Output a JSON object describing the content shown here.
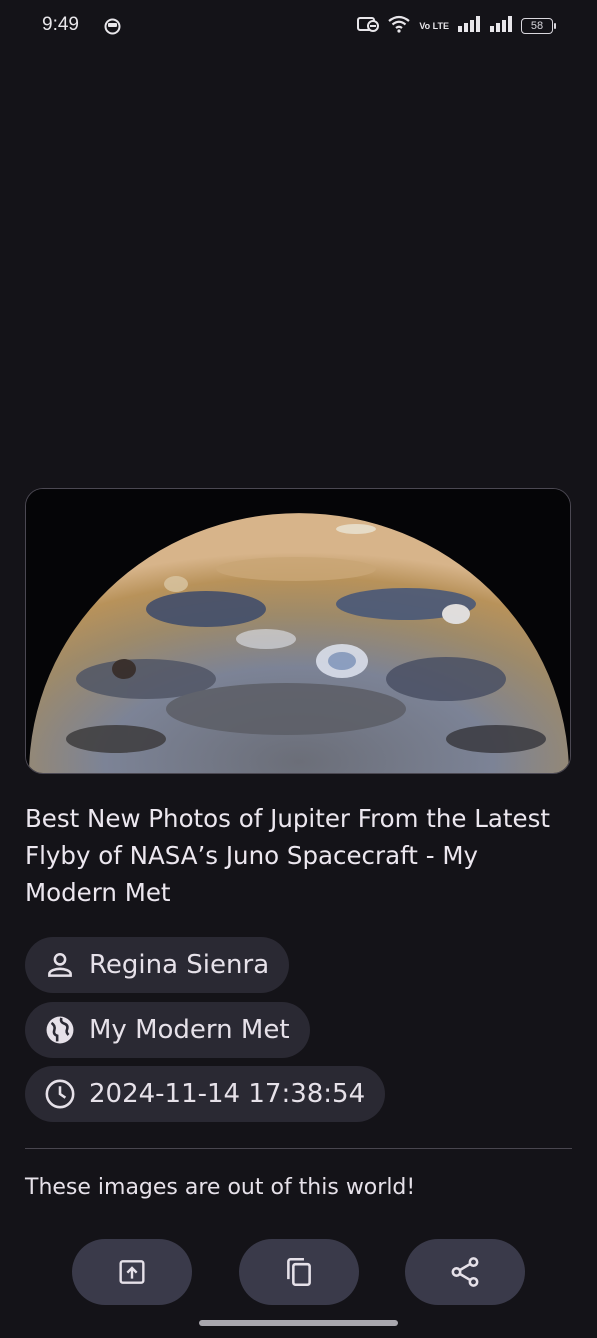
{
  "status_bar": {
    "time": "9:49",
    "battery": "58",
    "network_label": "Vo LTE"
  },
  "article": {
    "title": "Best New Photos of Jupiter From the Latest Flyby of NASA’s Juno Spacecraft - My Modern Met",
    "author": "Regina Sienra",
    "source": "My Modern Met",
    "datetime": "2024-11-14 17:38:54",
    "description": "These images are out of this world!"
  },
  "actions": [
    {
      "name": "open-in-browser",
      "icon": "open-external-icon"
    },
    {
      "name": "copy",
      "icon": "copy-icon"
    },
    {
      "name": "share",
      "icon": "share-icon"
    }
  ],
  "colors": {
    "background": "#141318",
    "chip_bg": "#2a2933",
    "button_bg": "#3a3a4a",
    "text": "#e6e1e9"
  }
}
